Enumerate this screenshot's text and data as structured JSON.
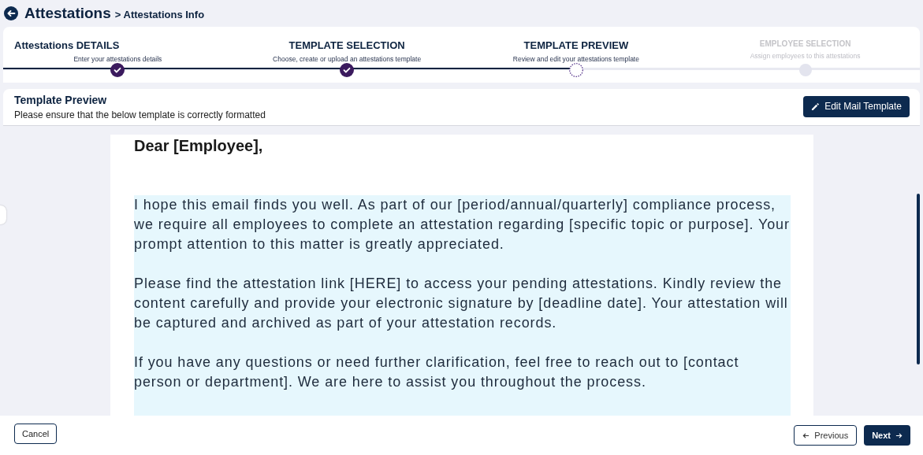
{
  "header": {
    "title": "Attestations",
    "breadcrumb": "> Attestations Info"
  },
  "steps": [
    {
      "title": "Attestations DETAILS",
      "subtitle": "Enter your attestations details",
      "completed": true,
      "selected": false
    },
    {
      "title": "TEMPLATE SELECTION",
      "subtitle": "Choose, create or upload an attestations template",
      "completed": true,
      "selected": false
    },
    {
      "title": "TEMPLATE PREVIEW",
      "subtitle": "Review and edit your attestations template",
      "completed": false,
      "selected": true
    },
    {
      "title": "EMPLOYEE SELECTION",
      "subtitle": "Assign employees to this attestations",
      "completed": false,
      "selected": false
    }
  ],
  "preview_header": {
    "title": "Template Preview",
    "subtitle": "Please ensure that the below template is correctly formatted",
    "button": "Edit Mail Template"
  },
  "document": {
    "greeting": "Dear [Employee],",
    "paragraphs": [
      "I hope this email finds you well. As part of our [period/annual/quarterly] compliance process, we require all employees to complete an attestation regarding [specific topic or purpose]. Your prompt attention to this matter is greatly appreciated.",
      "Please find the attestation link [HERE] to access your pending attestations. Kindly review the content carefully and provide your electronic signature by [deadline date]. Your attestation will be captured and archived as part of your attestation records.",
      "If you have any questions or need further clarification, feel free to reach out to [contact person or department]. We are here to assist you throughout the process."
    ]
  },
  "footer": {
    "cancel": "Cancel",
    "previous": "Previous",
    "next": "Next"
  }
}
